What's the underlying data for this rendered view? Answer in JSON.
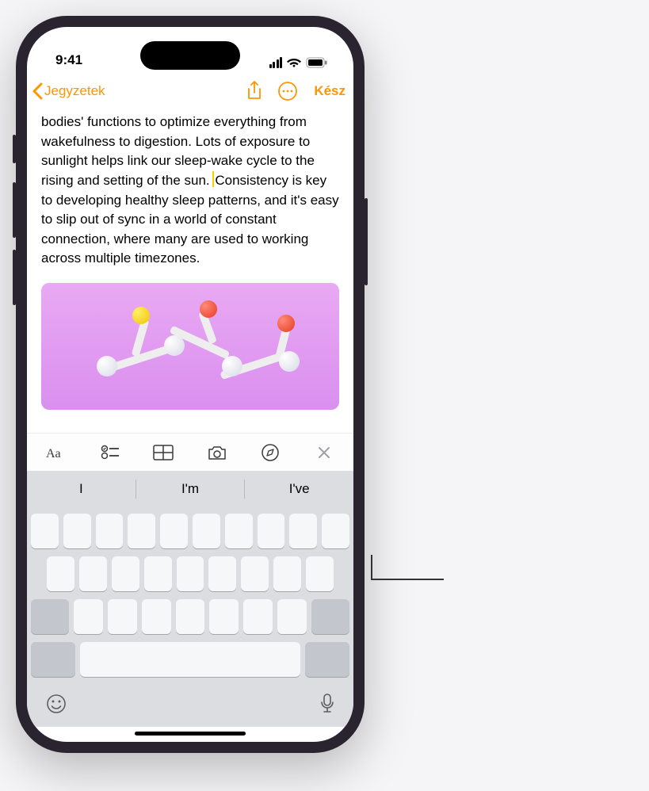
{
  "status": {
    "time": "9:41"
  },
  "nav": {
    "back_label": "Jegyzetek",
    "done_label": "Kész"
  },
  "note": {
    "text_before_cursor": "bodies' functions to optimize everything from wakefulness to digestion. Lots of exposure to sunlight helps link our sleep-wake cycle to the rising and setting of the sun. ",
    "text_after_cursor": "Consistency is key to developing healthy sleep patterns, and it's easy to slip out of sync in a world of constant connection, where many are used to working across multiple timezones."
  },
  "format_toolbar": {
    "items": [
      "text-style",
      "checklist",
      "table",
      "camera",
      "markup",
      "close"
    ]
  },
  "keyboard": {
    "suggestions": [
      "I",
      "I'm",
      "I've"
    ]
  },
  "colors": {
    "accent": "#ff9500",
    "cursor": "#ffcc00"
  }
}
